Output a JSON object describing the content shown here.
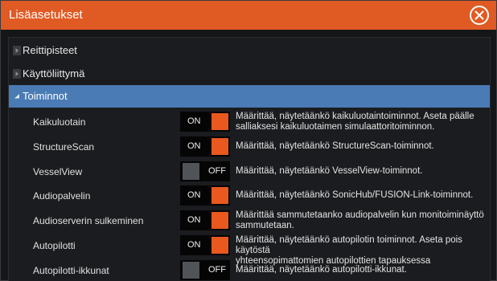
{
  "window": {
    "title": "Lisäasetukset",
    "close_icon": "close-circle-icon"
  },
  "colors": {
    "accent": "#e05a24",
    "selection": "#4a7bb4",
    "toggle_on_knob": "#e8581f",
    "toggle_off_knob": "#505459"
  },
  "categories": [
    {
      "label": "Reittipisteet",
      "expanded": false,
      "selected": false
    },
    {
      "label": "Käyttöliittymä",
      "expanded": false,
      "selected": false
    },
    {
      "label": "Toiminnot",
      "expanded": true,
      "selected": true
    }
  ],
  "settings": [
    {
      "name": "Kaikuluotain",
      "state": "ON",
      "on": true,
      "desc": [
        "Määrittää, näytetäänkö kaikuluotaintoiminnot. Aseta päälle",
        "salliaksesi kaikuluotaimen simulaattoritoiminnon."
      ]
    },
    {
      "name": "StructureScan",
      "state": "ON",
      "on": true,
      "desc": [
        "Määrittää, näytetäänkö StructureScan-toiminnot."
      ]
    },
    {
      "name": "VesselView",
      "state": "OFF",
      "on": false,
      "desc": [
        "Määrittää, näytetäänkö VesselView-toiminnot."
      ]
    },
    {
      "name": "Audiopalvelin",
      "state": "ON",
      "on": true,
      "desc": [
        "Määrittää, näytetäänkö SonicHub/FUSION-Link-toiminnot."
      ]
    },
    {
      "name": "Audioserverin sulkeminen",
      "state": "ON",
      "on": true,
      "desc": [
        "Määrittää sammutetaanko audiopalvelin kun monitoiminäyttö",
        "sammutetaan."
      ]
    },
    {
      "name": "Autopilotti",
      "state": "ON",
      "on": true,
      "desc": [
        "Määrittää, näytetäänkö autopilotin toiminnot. Aseta pois käytöstä",
        "yhteensopimattomien autopilottien tapauksessa"
      ]
    },
    {
      "name": "Autopilotti-ikkunat",
      "state": "OFF",
      "on": false,
      "desc": [
        "Määrittää, näytetäänkö autopilotti-ikkunat."
      ]
    }
  ]
}
